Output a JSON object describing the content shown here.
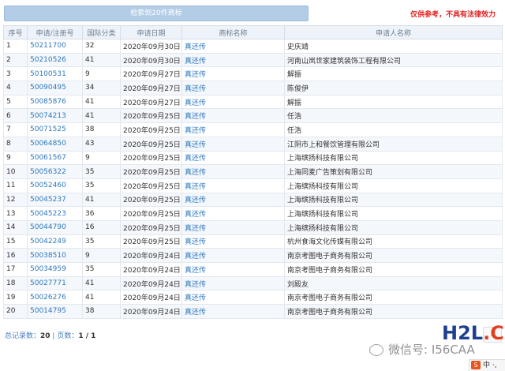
{
  "header": {
    "result_label": "检索到20件商标",
    "disclaimer": "仅供参考，不具有法律效力"
  },
  "columns": [
    "序号",
    "申请/注册号",
    "国际分类",
    "申请日期",
    "商标名称",
    "申请人名称"
  ],
  "rows": [
    {
      "no": "1",
      "app_no": "50211700",
      "cls": "32",
      "date": "2020年09月30日",
      "mark": "真还传",
      "applicant": "史庆靖"
    },
    {
      "no": "2",
      "app_no": "50210526",
      "cls": "41",
      "date": "2020年09月30日",
      "mark": "真还传",
      "applicant": "河南山岚世家建筑装饰工程有限公司"
    },
    {
      "no": "3",
      "app_no": "50100531",
      "cls": "9",
      "date": "2020年09月27日",
      "mark": "真还传",
      "applicant": "解振"
    },
    {
      "no": "4",
      "app_no": "50090495",
      "cls": "34",
      "date": "2020年09月27日",
      "mark": "真还传",
      "applicant": "陈俊伊"
    },
    {
      "no": "5",
      "app_no": "50085876",
      "cls": "41",
      "date": "2020年09月27日",
      "mark": "真还传",
      "applicant": "解振"
    },
    {
      "no": "6",
      "app_no": "50074213",
      "cls": "41",
      "date": "2020年09月25日",
      "mark": "真还传",
      "applicant": "任浩"
    },
    {
      "no": "7",
      "app_no": "50071525",
      "cls": "38",
      "date": "2020年09月25日",
      "mark": "真还传",
      "applicant": "任浩"
    },
    {
      "no": "8",
      "app_no": "50064850",
      "cls": "43",
      "date": "2020年09月25日",
      "mark": "真还传",
      "applicant": "江阴市上和餐饮管理有限公司"
    },
    {
      "no": "9",
      "app_no": "50061567",
      "cls": "9",
      "date": "2020年09月25日",
      "mark": "真还传",
      "applicant": "上海缤扬科技有限公司"
    },
    {
      "no": "10",
      "app_no": "50056322",
      "cls": "35",
      "date": "2020年09月25日",
      "mark": "真还传",
      "applicant": "上海同麦广告策划有限公司"
    },
    {
      "no": "11",
      "app_no": "50052460",
      "cls": "35",
      "date": "2020年09月25日",
      "mark": "真还传",
      "applicant": "上海缤扬科技有限公司"
    },
    {
      "no": "12",
      "app_no": "50045237",
      "cls": "41",
      "date": "2020年09月25日",
      "mark": "真还传",
      "applicant": "上海缤扬科技有限公司"
    },
    {
      "no": "13",
      "app_no": "50045223",
      "cls": "36",
      "date": "2020年09月25日",
      "mark": "真还传",
      "applicant": "上海缤扬科技有限公司"
    },
    {
      "no": "14",
      "app_no": "50044790",
      "cls": "16",
      "date": "2020年09月25日",
      "mark": "真还传",
      "applicant": "上海缤扬科技有限公司"
    },
    {
      "no": "15",
      "app_no": "50042249",
      "cls": "35",
      "date": "2020年09月25日",
      "mark": "真还传",
      "applicant": "杭州食海文化传媒有限公司"
    },
    {
      "no": "16",
      "app_no": "50038510",
      "cls": "9",
      "date": "2020年09月24日",
      "mark": "真还传",
      "applicant": "南京考图电子商务有限公司"
    },
    {
      "no": "17",
      "app_no": "50034959",
      "cls": "35",
      "date": "2020年09月24日",
      "mark": "真还传",
      "applicant": "南京考图电子商务有限公司"
    },
    {
      "no": "18",
      "app_no": "50027771",
      "cls": "41",
      "date": "2020年09月24日",
      "mark": "真还传",
      "applicant": "刘殿友"
    },
    {
      "no": "19",
      "app_no": "50026276",
      "cls": "41",
      "date": "2020年09月24日",
      "mark": "真还传",
      "applicant": "南京考图电子商务有限公司"
    },
    {
      "no": "20",
      "app_no": "50014795",
      "cls": "38",
      "date": "2020年09月24日",
      "mark": "真还传",
      "applicant": "南京考图电子商务有限公司"
    }
  ],
  "footer": {
    "total_label": "总记录数：",
    "total_value": "20",
    "separator": " | ",
    "pages_label": "页数：",
    "pages_value": "1 / 1",
    "page_button": "1"
  },
  "watermark": {
    "wechat_text": "微信号: I56CAA",
    "site_a": "H2L",
    "site_b": ".CN"
  },
  "ime": {
    "logo": "S",
    "mode": "中",
    "punct": "·,"
  }
}
